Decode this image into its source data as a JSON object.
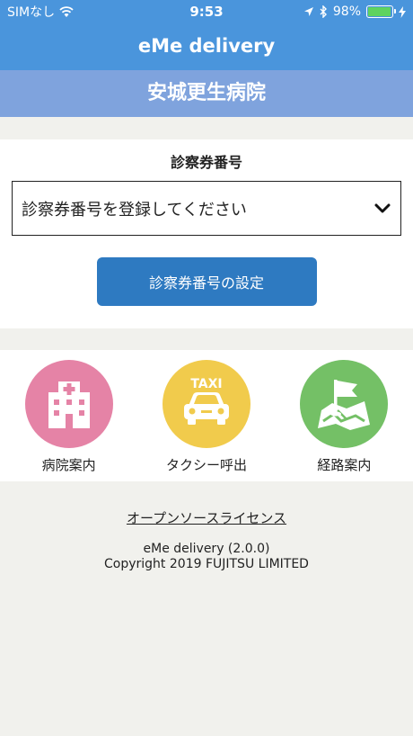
{
  "status_bar": {
    "carrier": "SIMなし",
    "time": "9:53",
    "battery": "98%",
    "battery_level": 0.98
  },
  "header": {
    "app_title": "eMe delivery",
    "hospital_name": "安城更生病院"
  },
  "registration": {
    "title": "診察券番号",
    "select_value": "診察券番号を登録してください",
    "button_label": "診察券番号の設定"
  },
  "menu": {
    "items": [
      {
        "label": "病院案内",
        "icon": "hospital-icon",
        "color": "#e583a6"
      },
      {
        "label": "タクシー呼出",
        "icon": "taxi-icon",
        "color": "#f1cb4c",
        "icon_text": "TAXI"
      },
      {
        "label": "経路案内",
        "icon": "map-flag-icon",
        "color": "#74c066"
      }
    ]
  },
  "footer": {
    "license_link": "オープンソースライセンス",
    "version": "eMe delivery (2.0.0)",
    "copyright": "Copyright 2019 FUJITSU LIMITED"
  }
}
